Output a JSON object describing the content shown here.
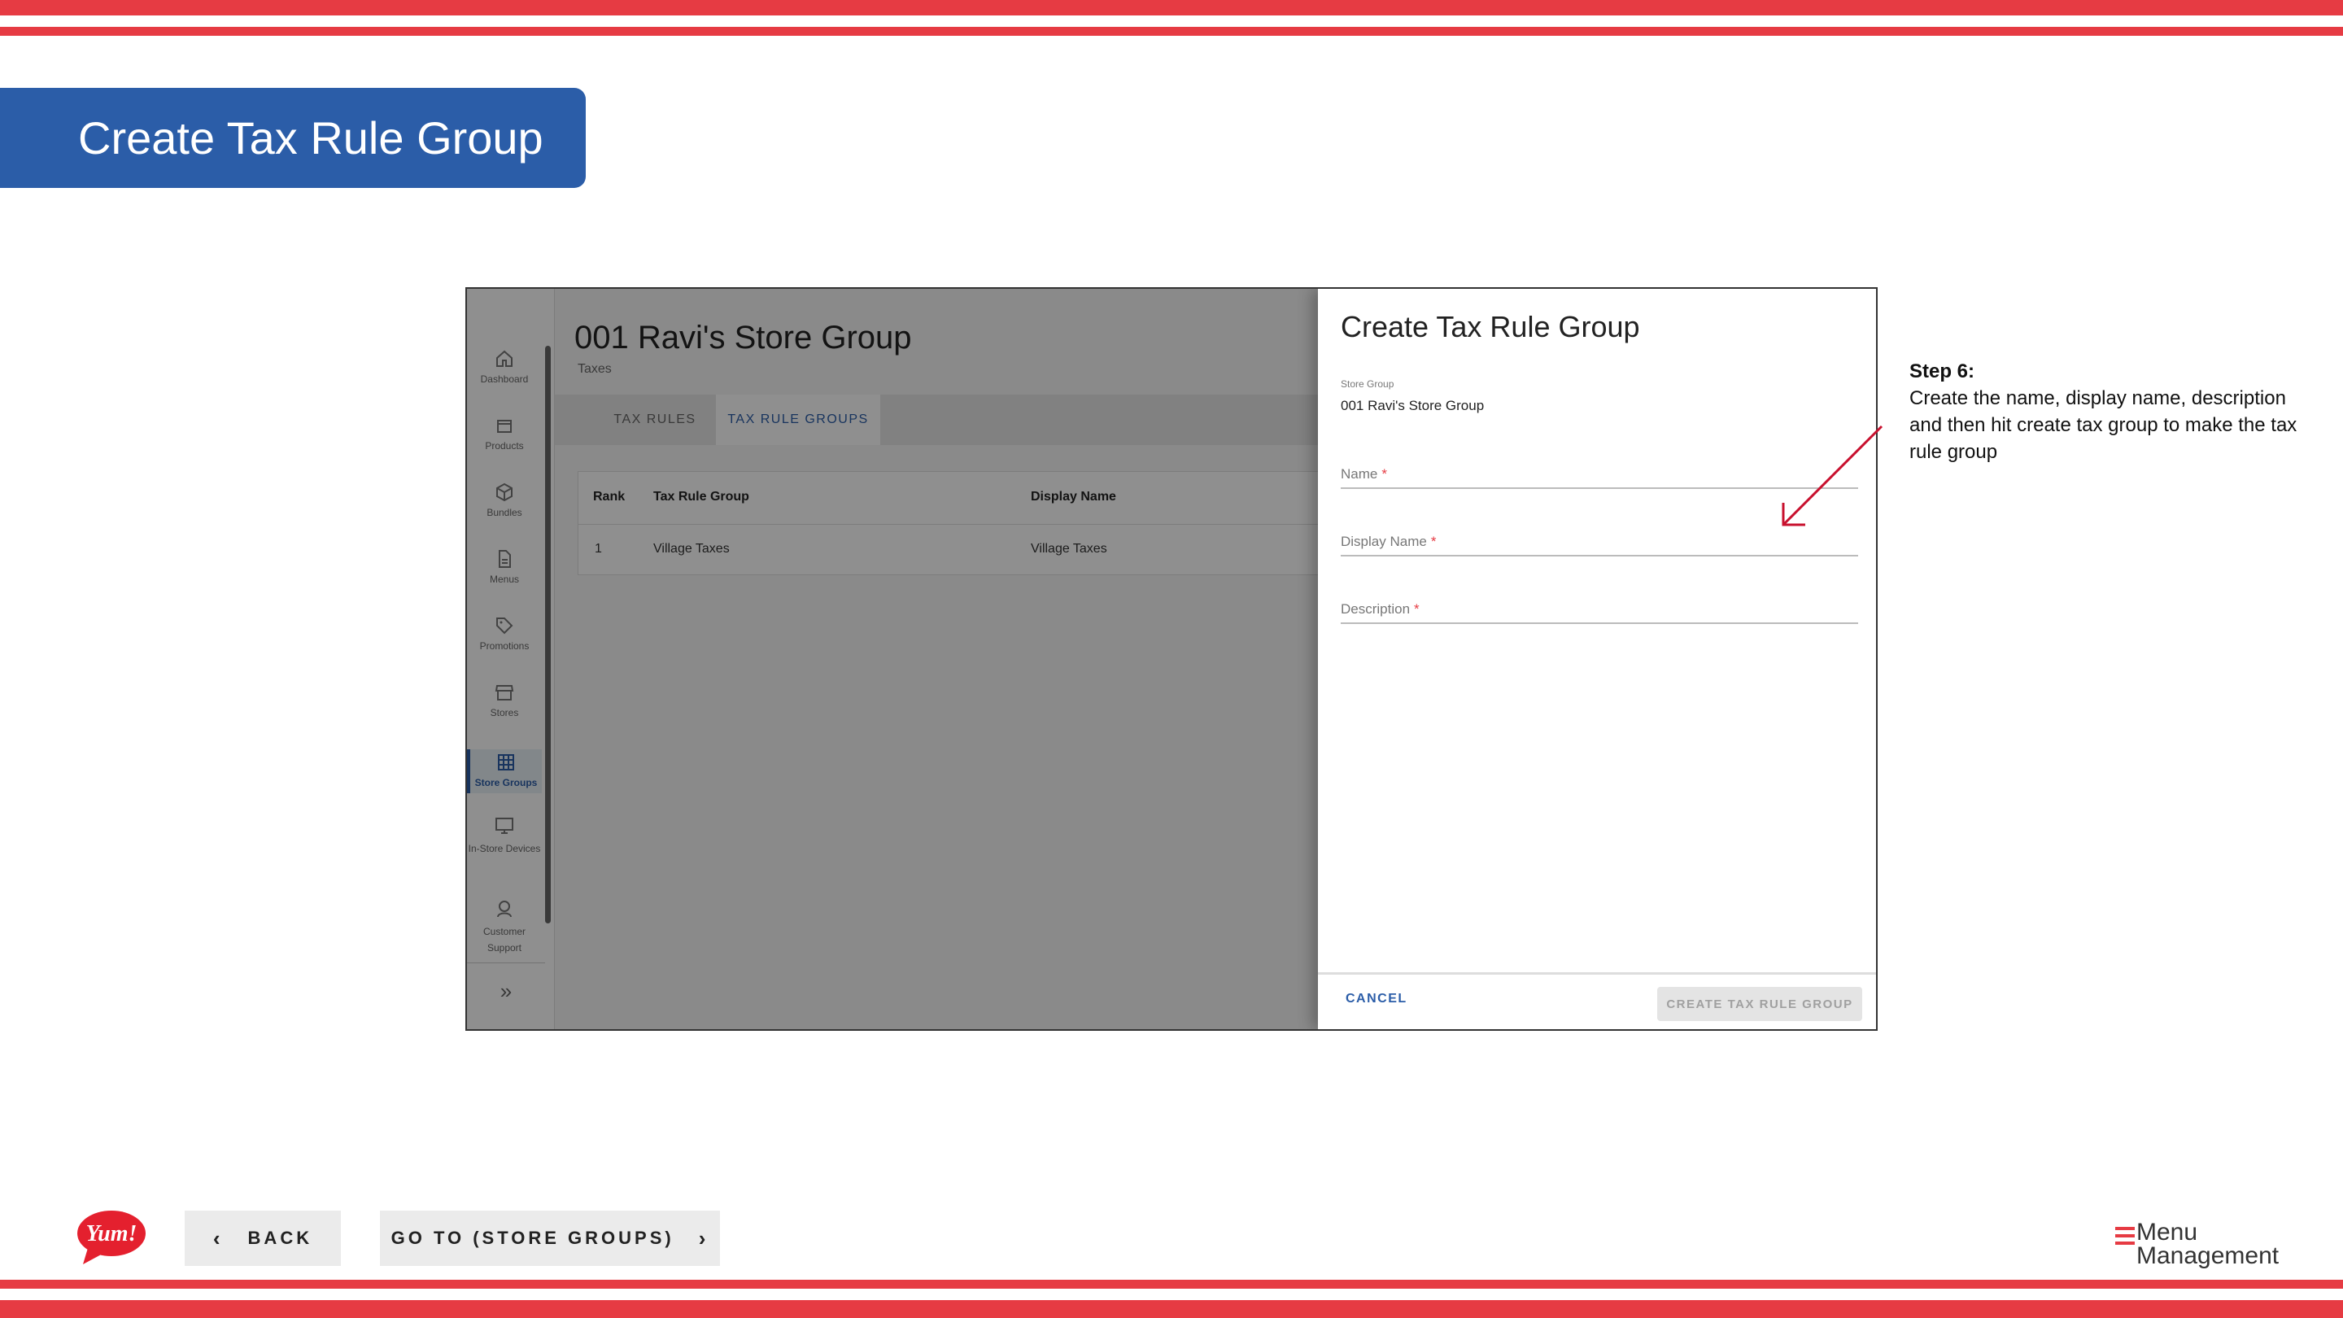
{
  "slide": {
    "title": "Create Tax Rule Group"
  },
  "app": {
    "sidebar": {
      "items": [
        {
          "label": "Dashboard",
          "icon": "home-icon"
        },
        {
          "label": "Products",
          "icon": "box-icon"
        },
        {
          "label": "Bundles",
          "icon": "cube-icon"
        },
        {
          "label": "Menus",
          "icon": "document-icon"
        },
        {
          "label": "Promotions",
          "icon": "tag-icon"
        },
        {
          "label": "Stores",
          "icon": "store-icon"
        },
        {
          "label": "Store Groups",
          "icon": "grid-icon",
          "active": true
        },
        {
          "label": "In-Store Devices",
          "icon": "monitor-icon"
        },
        {
          "label": "Customer Support",
          "icon": "support-icon"
        }
      ],
      "expand_icon": "»"
    },
    "page": {
      "title": "001 Ravi's Store Group",
      "subtitle": "Taxes"
    },
    "tabs": [
      {
        "label": "TAX RULES"
      },
      {
        "label": "TAX RULE GROUPS",
        "active": true
      }
    ],
    "table": {
      "headers": [
        "Rank",
        "Tax Rule Group",
        "Display Name"
      ],
      "rows": [
        [
          "1",
          "Village Taxes",
          "Village Taxes"
        ]
      ]
    },
    "drawer": {
      "title": "Create Tax Rule Group",
      "store_group_label": "Store Group",
      "store_group_value": "001 Ravi's Store Group",
      "fields": [
        {
          "label": "Name",
          "required": "*"
        },
        {
          "label": "Display Name",
          "required": "*"
        },
        {
          "label": "Description",
          "required": "*"
        }
      ],
      "cancel_label": "CANCEL",
      "create_label": "CREATE TAX RULE GROUP"
    }
  },
  "annotation": {
    "step_heading": "Step 6:",
    "step_text": "Create the name, display name, description and then hit create tax group to make the tax rule group",
    "arrow_color": "#c8102e"
  },
  "bottom_nav": {
    "back_label": "BACK",
    "goto_label": "GO TO (STORE GROUPS)",
    "brand_logo": "Yum!",
    "product_logo_line1": "Menu",
    "product_logo_line2": "Management"
  },
  "colors": {
    "accent_red": "#e63b43",
    "brand_blue": "#2b5da8"
  }
}
